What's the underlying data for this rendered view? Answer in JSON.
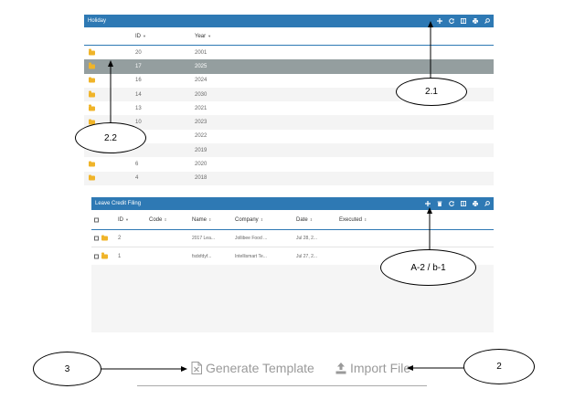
{
  "holiday": {
    "title": "Holiday",
    "columns": [
      {
        "label": "ID",
        "sort": "▼"
      },
      {
        "label": "Year",
        "sort": "▼"
      }
    ],
    "rows": [
      {
        "id": "20",
        "year": "2001"
      },
      {
        "id": "17",
        "year": "2025"
      },
      {
        "id": "16",
        "year": "2024"
      },
      {
        "id": "14",
        "year": "2030"
      },
      {
        "id": "13",
        "year": "2021"
      },
      {
        "id": "10",
        "year": "2023"
      },
      {
        "id": "",
        "year": "2022"
      },
      {
        "id": "",
        "year": "2019"
      },
      {
        "id": "6",
        "year": "2020"
      },
      {
        "id": "4",
        "year": "2018"
      }
    ],
    "tools": [
      "plus-icon",
      "refresh-icon",
      "columns-icon",
      "print-icon",
      "search-icon"
    ]
  },
  "leave": {
    "title": "Leave Credit Filing",
    "columns": [
      {
        "label": "ID",
        "sort": "▼"
      },
      {
        "label": "Code",
        "sort": "⇕"
      },
      {
        "label": "Name",
        "sort": "⇕"
      },
      {
        "label": "Company",
        "sort": "⇕"
      },
      {
        "label": "Date",
        "sort": "⇕"
      },
      {
        "label": "Executed",
        "sort": "⇕"
      }
    ],
    "rows": [
      {
        "id": "2",
        "code": "",
        "name": "2017 Lea...",
        "company": "Jollibee Food ...",
        "date": "Jul 28, 2..."
      },
      {
        "id": "1",
        "code": "",
        "name": "fsdxfdyf...",
        "company": "Intellismart Te...",
        "date": "Jul 27, 2..."
      }
    ],
    "tools": [
      "plus-icon",
      "trash-icon",
      "refresh-icon",
      "columns-icon",
      "print-icon",
      "search-icon"
    ]
  },
  "actions": {
    "generate_label": "Generate Template",
    "import_label": "Import File"
  },
  "annotations": {
    "a21": "2.1",
    "a22": "2.2",
    "a_a2": "A-2 / b-1",
    "a3": "3",
    "a2": "2"
  }
}
